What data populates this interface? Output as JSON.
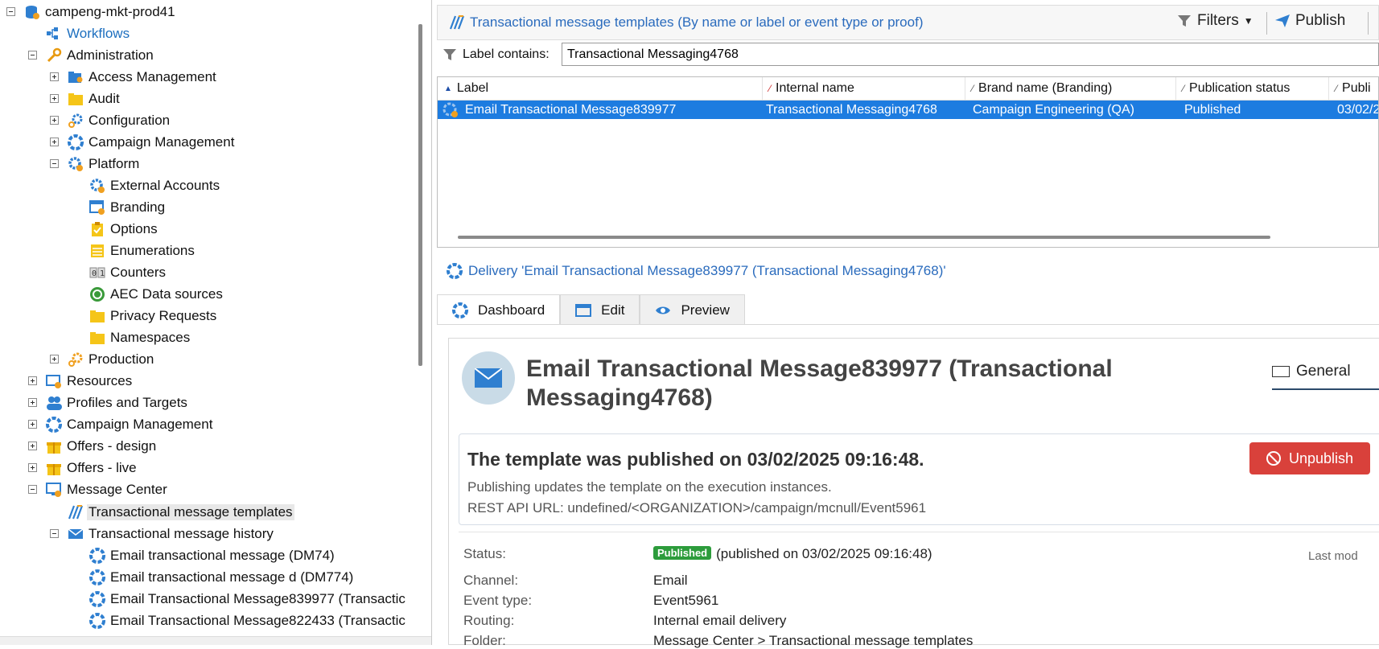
{
  "tree": {
    "root": "campeng-mkt-prod41",
    "workflows": "Workflows",
    "administration": "Administration",
    "access_management": "Access Management",
    "audit": "Audit",
    "configuration": "Configuration",
    "campaign_management_admin": "Campaign Management",
    "platform": "Platform",
    "external_accounts": "External Accounts",
    "branding": "Branding",
    "options": "Options",
    "enumerations": "Enumerations",
    "counters": "Counters",
    "aec_data_sources": "AEC Data sources",
    "privacy_requests": "Privacy Requests",
    "namespaces": "Namespaces",
    "production": "Production",
    "resources": "Resources",
    "profiles_targets": "Profiles and Targets",
    "campaign_management": "Campaign Management",
    "offers_design": "Offers - design",
    "offers_live": "Offers - live",
    "message_center": "Message Center",
    "tx_templates": "Transactional message templates",
    "tx_history": "Transactional message history",
    "history_items": [
      "Email transactional message (DM74)",
      "Email transactional message d (DM774)",
      "Email Transactional Message839977 (Transactic",
      "Email Transactional Message822433 (Transactic"
    ]
  },
  "list": {
    "title": "Transactional message templates (By name or label or event type or proof)",
    "filters_label": "Filters",
    "publish_label": "Publish",
    "filter_label": "Label contains:",
    "filter_value": "Transactional Messaging4768",
    "columns": [
      "Label",
      "Internal name",
      "Brand name (Branding)",
      "Publication status",
      "Publi"
    ],
    "row": {
      "label": "Email Transactional Message839977",
      "internal_name": "Transactional Messaging4768",
      "brand": "Campaign Engineering (QA)",
      "status": "Published",
      "date": "03/02/2"
    }
  },
  "delivery": {
    "title": "Delivery 'Email Transactional Message839977 (Transactional Messaging4768)'",
    "tabs": [
      "Dashboard",
      "Edit",
      "Preview"
    ]
  },
  "dashboard": {
    "title": "Email Transactional Message839977 (Transactional Messaging4768)",
    "general_tab": "General",
    "published_heading": "The template was published on 03/02/2025 09:16:48.",
    "published_desc": "Publishing updates the template on the execution instances.",
    "api_url": "REST API URL: undefined/<ORGANIZATION>/campaign/mcnull/Event5961",
    "unpublish_label": "Unpublish",
    "status_key": "Status:",
    "status_badge": "Published",
    "status_value": "(published on 03/02/2025 09:16:48)",
    "last_modified": "Last mod",
    "channel_key": "Channel:",
    "channel_value": "Email",
    "event_key": "Event type:",
    "event_value": "Event5961",
    "routing_key": "Routing:",
    "routing_value": "Internal email delivery",
    "folder_key": "Folder:",
    "folder_value": "Message Center > Transactional message templates"
  },
  "colors": {
    "selection": "#1d7ce0",
    "link_blue": "#2a6bbd",
    "unpublish_red": "#d9413b",
    "badge_green": "#2d9c3c"
  }
}
